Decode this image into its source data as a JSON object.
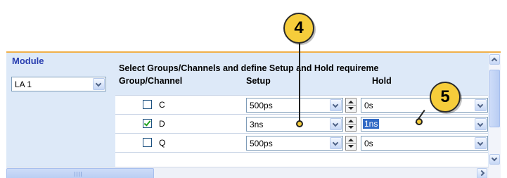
{
  "module": {
    "title": "Module",
    "selected": "LA 1"
  },
  "instructions": "Select Groups/Channels and define Setup and Hold requireme",
  "columns": {
    "group": "Group/Channel",
    "setup": "Setup",
    "hold": "Hold"
  },
  "rows": [
    {
      "channel": "C",
      "checked": false,
      "setup": "500ps",
      "hold": "0s",
      "hold_selected": false
    },
    {
      "channel": "D",
      "checked": true,
      "setup": "3ns",
      "hold": "1ns",
      "hold_selected": true
    },
    {
      "channel": "Q",
      "checked": false,
      "setup": "500ps",
      "hold": "0s",
      "hold_selected": false
    }
  ],
  "callouts": [
    "4",
    "5"
  ],
  "colors": {
    "callout_fill": "#f6cd3b",
    "panel_bg": "#dde9f8",
    "module_title": "#2a3fb0",
    "selection": "#316ac5"
  }
}
